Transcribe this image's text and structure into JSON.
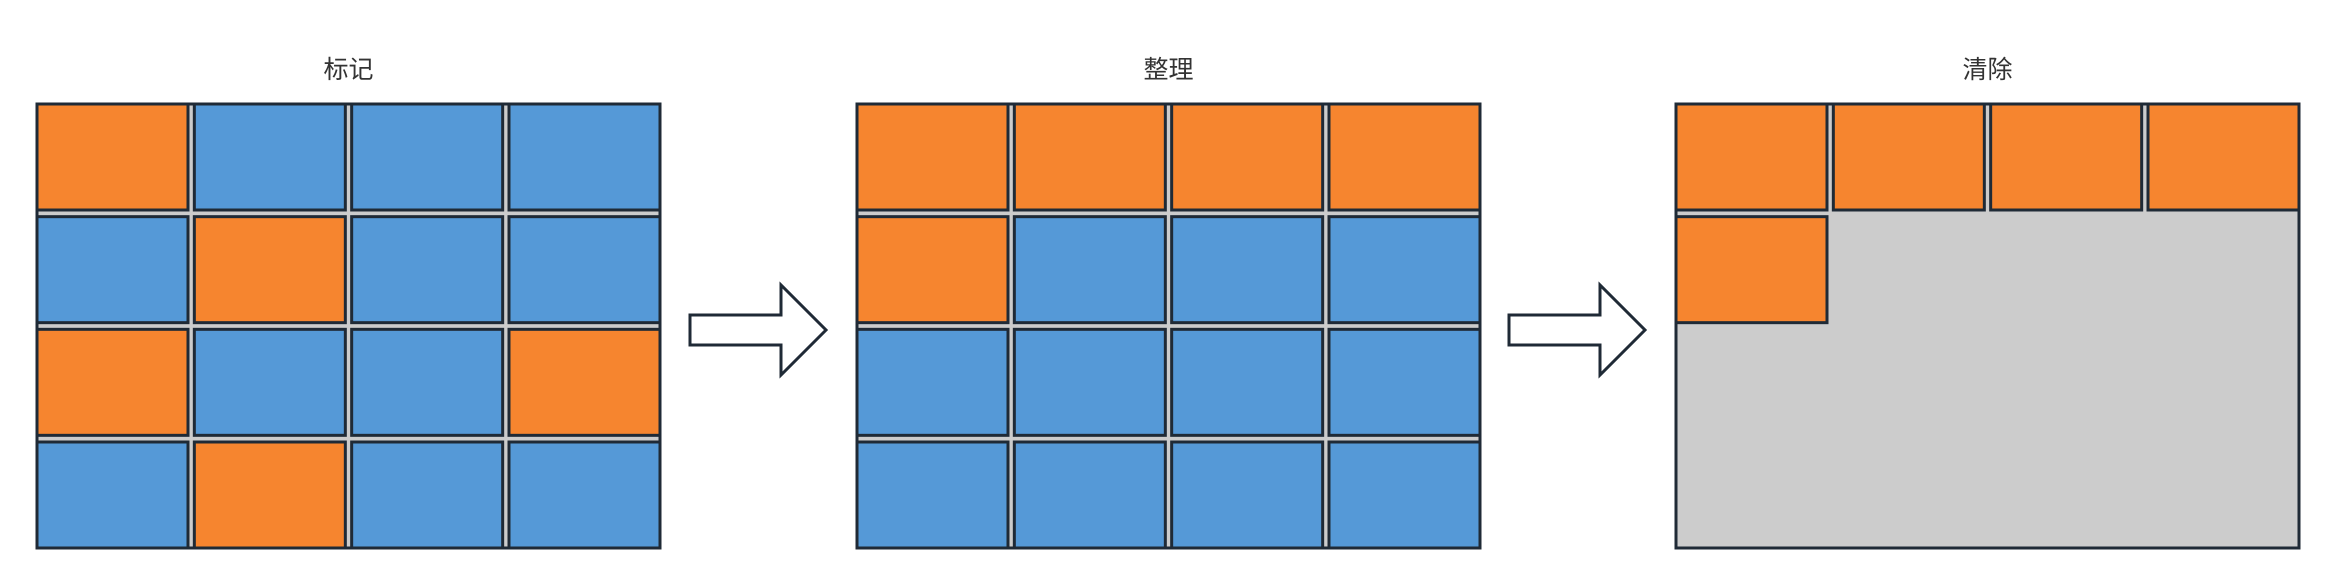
{
  "colors": {
    "marked": "#f6852f",
    "live": "#5599d7",
    "free": "#cccccc",
    "stroke": "#1f2a36"
  },
  "panels": [
    {
      "title": "标记",
      "cells": [
        [
          "marked",
          "live",
          "live",
          "live"
        ],
        [
          "live",
          "marked",
          "live",
          "live"
        ],
        [
          "marked",
          "live",
          "live",
          "marked"
        ],
        [
          "live",
          "marked",
          "live",
          "live"
        ]
      ]
    },
    {
      "title": "整理",
      "cells": [
        [
          "marked",
          "marked",
          "marked",
          "marked"
        ],
        [
          "marked",
          "live",
          "live",
          "live"
        ],
        [
          "live",
          "live",
          "live",
          "live"
        ],
        [
          "live",
          "live",
          "live",
          "live"
        ]
      ]
    },
    {
      "title": "清除",
      "cells": [
        [
          "marked",
          "marked",
          "marked",
          "marked"
        ],
        [
          "marked",
          "free",
          "free",
          "free"
        ],
        [
          "free",
          "free",
          "free",
          "free"
        ],
        [
          "free",
          "free",
          "free",
          "free"
        ]
      ]
    }
  ],
  "arrows": [
    {
      "from": "标记",
      "to": "整理"
    },
    {
      "from": "整理",
      "to": "清除"
    }
  ]
}
